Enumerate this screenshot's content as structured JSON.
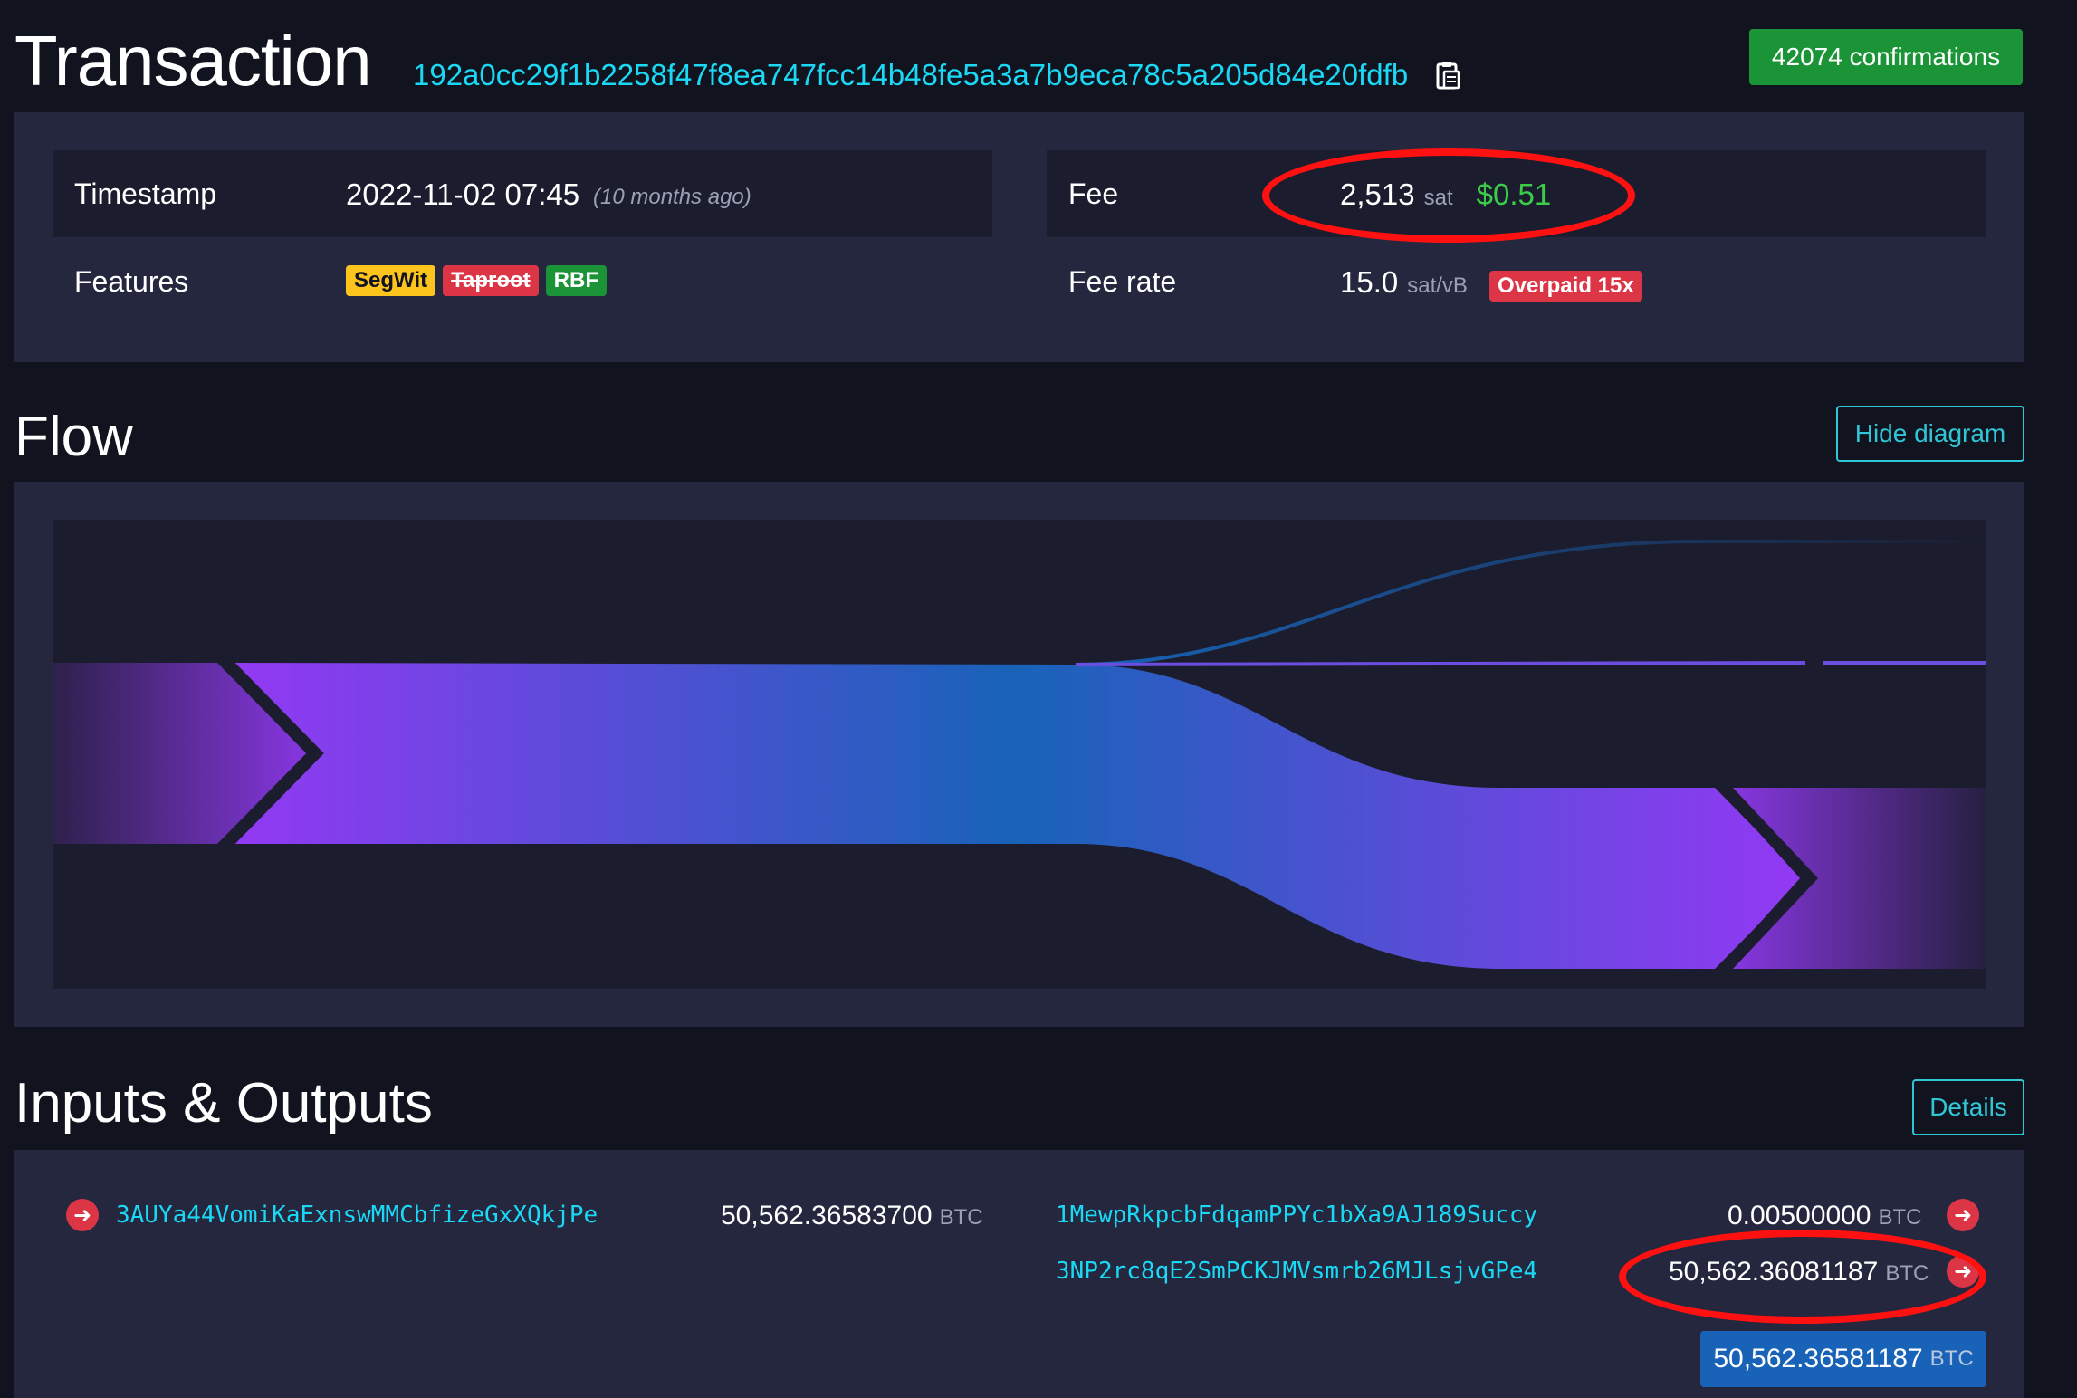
{
  "header": {
    "title": "Transaction",
    "txid": "192a0cc29f1b2258f47f8ea747fcc14b48fe5a3a7b9eca78c5a205d84e20fdfb",
    "copy_icon": "clipboard-icon",
    "confirmations": "42074 confirmations"
  },
  "details": {
    "timestamp_label": "Timestamp",
    "timestamp_value": "2022-11-02 07:45",
    "timestamp_relative": "(10 months ago)",
    "features_label": "Features",
    "features": [
      "SegWit",
      "Taproot",
      "RBF"
    ],
    "fee_label": "Fee",
    "fee_value": "2,513",
    "fee_unit": "sat",
    "fee_usd": "$0.51",
    "feerate_label": "Fee rate",
    "feerate_value": "15.0",
    "feerate_unit": "sat/vB",
    "overpaid": "Overpaid 15x"
  },
  "flow": {
    "title": "Flow",
    "hide_button": "Hide diagram"
  },
  "io": {
    "title": "Inputs & Outputs",
    "details_button": "Details",
    "inputs": [
      {
        "address": "3AUYa44VomiKaExnswMMCbfizeGxXQkjPe",
        "amount": "50,562.36583700",
        "unit": "BTC"
      }
    ],
    "outputs": [
      {
        "address": "1MewpRkpcbFdqamPPYc1bXa9AJ189Succy",
        "amount": "0.00500000",
        "unit": "BTC"
      },
      {
        "address": "3NP2rc8qE2SmPCKJMVsmrb26MJLsjvGPe4",
        "amount": "50,562.36081187",
        "unit": "BTC"
      }
    ],
    "total_amount": "50,562.36581187",
    "total_unit": "BTC"
  },
  "colors": {
    "accent_cyan": "#1bd8f4",
    "green": "#1a9436",
    "red": "#dc3545",
    "yellow": "#fec41e",
    "purple": "#9339f4",
    "blue": "#1863b8",
    "annotation_red": "#ff1111"
  }
}
